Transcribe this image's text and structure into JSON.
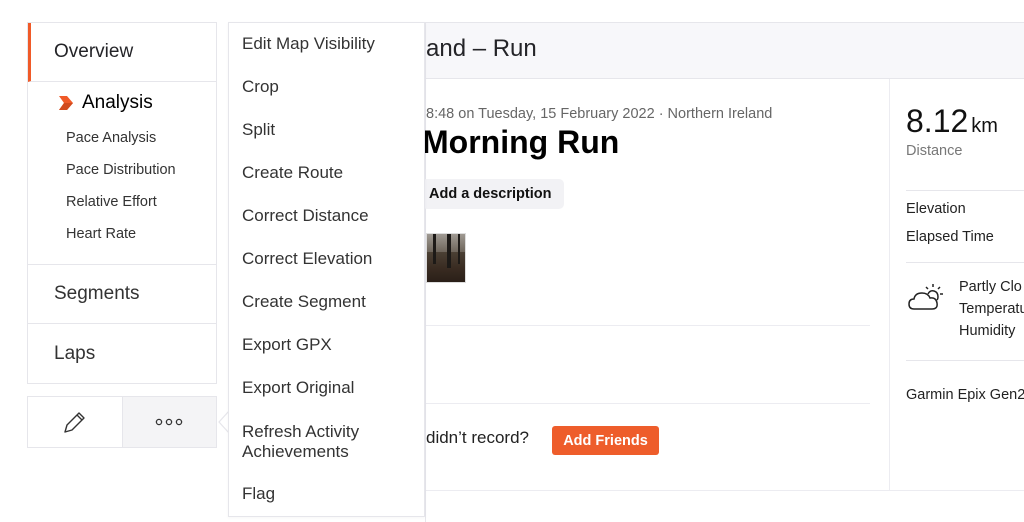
{
  "sidebar": {
    "overview": "Overview",
    "analysis": "Analysis",
    "analysis_items": [
      "Pace Analysis",
      "Pace Distribution",
      "Relative Effort",
      "Heart Rate"
    ],
    "segments": "Segments",
    "laps": "Laps",
    "accent_color": "#f05a28"
  },
  "actions": {
    "edit_icon": "pencil-icon",
    "more_icon": "ellipsis-icon"
  },
  "menu": {
    "items": [
      "Edit Map Visibility",
      "Crop",
      "Split",
      "Create Route",
      "Correct Distance",
      "Correct Elevation",
      "Create Segment",
      "Export GPX",
      "Export Original",
      "Refresh Activity Achievements",
      "Flag"
    ],
    "refresh_line1": "Refresh Activity",
    "refresh_line2": "Achievements"
  },
  "header": {
    "title": "and – Run"
  },
  "activity": {
    "meta": "8:48 on Tuesday, 15 February 2022 · Northern Ireland",
    "title": "Morning Run",
    "add_description": "Add a description",
    "friends_prompt": "didn’t record?",
    "add_friends": "Add Friends",
    "button_color": "#ee5d2b"
  },
  "stats": {
    "distance_value": "8.12",
    "distance_unit": "km",
    "distance_label": "Distance",
    "elevation_label": "Elevation",
    "elapsed_label": "Elapsed Time",
    "weather_icon": "partly-cloudy-icon",
    "weather_condition": "Partly Clo",
    "temperature_label": "Temperatu",
    "humidity_label": "Humidity",
    "device": "Garmin Epix Gen2"
  }
}
